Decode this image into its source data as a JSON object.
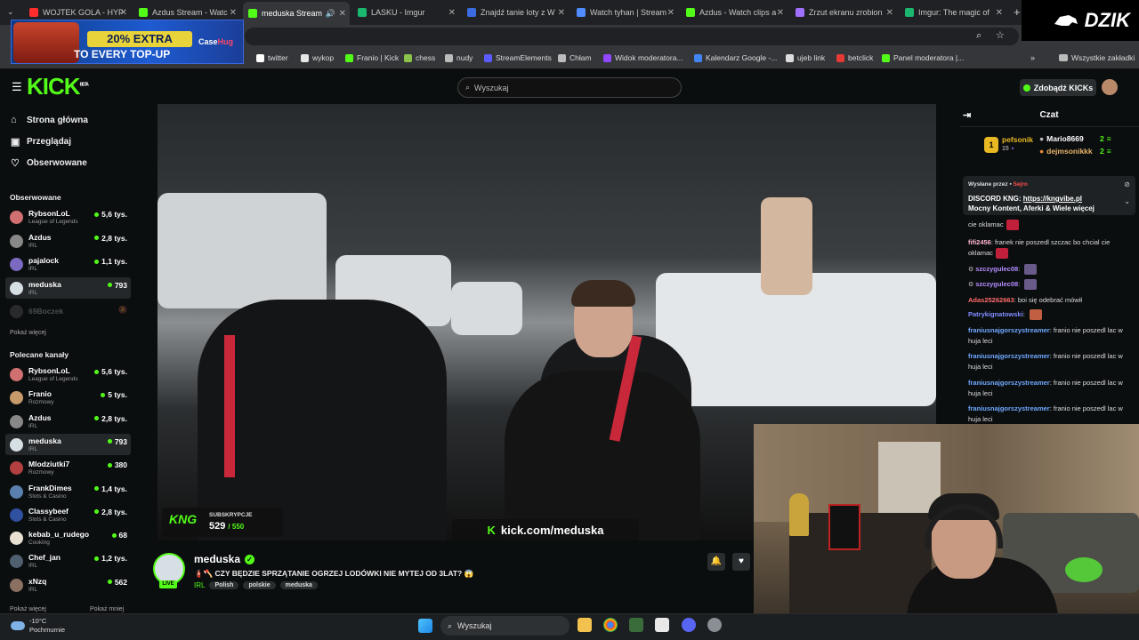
{
  "browser": {
    "tabs": [
      {
        "label": "WOJTEK GOLA - HYP",
        "color": "#ff2d2d"
      },
      {
        "label": "Azdus Stream - Watc",
        "color": "#53fc18"
      },
      {
        "label": "meduska Stream",
        "color": "#53fc18",
        "active": true
      },
      {
        "label": "LASKU - Imgur",
        "color": "#1bb76e"
      },
      {
        "label": "Znajdź tanie loty z W",
        "color": "#3b6be0"
      },
      {
        "label": "Watch tyhan | Stream",
        "color": "#4e8cff"
      },
      {
        "label": "Azdus - Watch clips a",
        "color": "#53fc18"
      },
      {
        "label": "Zrzut ekranu zrobion",
        "color": "#a070ff"
      },
      {
        "label": "Imgur: The magic of",
        "color": "#1bb76e"
      }
    ],
    "bookmarks": [
      {
        "label": "twitter",
        "color": "#ffffff"
      },
      {
        "label": "wykop",
        "color": "#e6e6e6"
      },
      {
        "label": "Franio | Kick",
        "color": "#53fc18"
      },
      {
        "label": "chess",
        "color": "#8bc34a"
      },
      {
        "label": "nudy",
        "color": "#bbbbbb"
      },
      {
        "label": "StreamElements",
        "color": "#5b5bff"
      },
      {
        "label": "Chłam",
        "color": "#bbbbbb"
      },
      {
        "label": "Widok moderatora...",
        "color": "#9146ff"
      },
      {
        "label": "Kalendarz Google -...",
        "color": "#4285f4"
      },
      {
        "label": "ujeb link",
        "color": "#dddddd"
      },
      {
        "label": "betclick",
        "color": "#e53935"
      },
      {
        "label": "Panel moderatora |...",
        "color": "#53fc18"
      }
    ],
    "all_bookmarks": "Wszystkie zakładki"
  },
  "ad": {
    "line1": "20% EXTRA",
    "line2": "TO EVERY TOP-UP",
    "brand_a": "Case",
    "brand_b": "Hug"
  },
  "overlay_brand": "DZIK",
  "kick": {
    "logo": "KICK",
    "beta": "BETA",
    "search_placeholder": "Wyszukaj",
    "kicks_button": "Zdobądź KICKs"
  },
  "sidebar": {
    "nav": [
      {
        "label": "Strona główna",
        "icon": "home-icon"
      },
      {
        "label": "Przeglądaj",
        "icon": "browse-icon"
      },
      {
        "label": "Obserwowane",
        "icon": "heart-icon"
      }
    ],
    "followed_title": "Obserwowane",
    "followed": [
      {
        "name": "RybsonLoL",
        "category": "League of Legends",
        "viewers": "5,6 tys.",
        "color": "#d07070"
      },
      {
        "name": "Azdus",
        "category": "IRL",
        "viewers": "2,8 tys.",
        "color": "#888888"
      },
      {
        "name": "pajalock",
        "category": "IRL",
        "viewers": "1,1 tys.",
        "color": "#7a6ac0"
      },
      {
        "name": "meduska",
        "category": "IRL",
        "viewers": "793",
        "color": "#d6dfe3",
        "selected": true
      },
      {
        "name": "69Boczek",
        "category": "",
        "viewers": "",
        "color": "#555555",
        "offline": true
      }
    ],
    "show_more": "Pokaż więcej",
    "recommended_title": "Polecane kanały",
    "recommended": [
      {
        "name": "RybsonLoL",
        "category": "League of Legends",
        "viewers": "5,6 tys.",
        "color": "#d07070"
      },
      {
        "name": "Franio",
        "category": "Rozmowy",
        "viewers": "5 tys.",
        "color": "#c79a6a"
      },
      {
        "name": "Azdus",
        "category": "IRL",
        "viewers": "2,8 tys.",
        "color": "#888888"
      },
      {
        "name": "meduska",
        "category": "IRL",
        "viewers": "793",
        "color": "#d6dfe3",
        "selected": true
      },
      {
        "name": "Mlodziutki7",
        "category": "Rozmowy",
        "viewers": "380",
        "color": "#b24040"
      },
      {
        "name": "FrankDimes",
        "category": "Slots & Casino",
        "viewers": "1,4 tys.",
        "color": "#5a80b0"
      },
      {
        "name": "Classybeef",
        "category": "Slots & Casino",
        "viewers": "2,8 tys.",
        "color": "#3050a0"
      },
      {
        "name": "kebab_u_rudego",
        "category": "Cooking",
        "viewers": "68",
        "color": "#e8e0d0"
      },
      {
        "name": "Chef_jan",
        "category": "IRL",
        "viewers": "1,2 tys.",
        "color": "#506070"
      },
      {
        "name": "xNzq",
        "category": "IRL",
        "viewers": "562",
        "color": "#8a7060"
      }
    ],
    "show_more2": "Pokaż więcej",
    "show_less": "Pokaż mniej"
  },
  "video": {
    "subs_label": "SUBSKRYPCJE",
    "subs_count": "529",
    "subs_goal": "/ 550",
    "subs_logo": "KNG",
    "url_prefix": "kick.com/",
    "url_channel": "meduska"
  },
  "stream": {
    "live": "LIVE",
    "name": "meduska",
    "title": "🧯🪓 CZY BĘDZIE SPRZĄTANIE OGRZEJ LODÓWKI NIE MYTEJ OD 3LAT? 😱",
    "category": "IRL",
    "tags": [
      "Polish",
      "polskie",
      "meduska"
    ]
  },
  "chat": {
    "title": "Czat",
    "leaderboard": {
      "rank": "1",
      "top_name": "pefsonik",
      "top_count": "15",
      "entries": [
        {
          "name": "Mario8669",
          "count": "2"
        },
        {
          "name": "dejmsonikkk",
          "count": "2"
        }
      ]
    },
    "pinned": {
      "by_label": "Wysłane przez",
      "by_user": "Sejro",
      "message": "DISCORD KNG: ",
      "link": "https://kngvibe.pl",
      "message2": "Mocny Kontent, Aferki & Wiele więcej"
    },
    "messages": [
      {
        "user": "",
        "text": "cie oklamac",
        "color": "#ddd"
      },
      {
        "user": "fifi2456",
        "text": "franek nie poszedl szczac bo chcial cie oklamac",
        "color": "#ffb3d0"
      },
      {
        "user": "szczygulec08",
        "text": "",
        "color": "#b48cff"
      },
      {
        "user": "szczygulec08",
        "text": "",
        "color": "#b48cff"
      },
      {
        "user": "Adas25262663",
        "text": "boi się odebrać mówił",
        "color": "#ff6b6b"
      },
      {
        "user": "Patrykignatowski",
        "text": "",
        "color": "#7f8cff"
      },
      {
        "user": "franiusnajgorszystreamer",
        "text": "franio nie poszedl lac w huja leci",
        "color": "#6fa8ff"
      },
      {
        "user": "franiusnajgorszystreamer",
        "text": "franio nie poszedl lac w huja leci",
        "color": "#6fa8ff"
      },
      {
        "user": "franiusnajgorszystreamer",
        "text": "franio nie poszedl lac w huja leci",
        "color": "#6fa8ff"
      },
      {
        "user": "franiusnajgorszystreamer",
        "text": "franio nie poszedl lac w huja leci",
        "color": "#6fa8ff"
      }
    ]
  },
  "taskbar": {
    "temperature": "-10°C",
    "weather": "Pochmurnie",
    "search": "Wyszukaj"
  }
}
